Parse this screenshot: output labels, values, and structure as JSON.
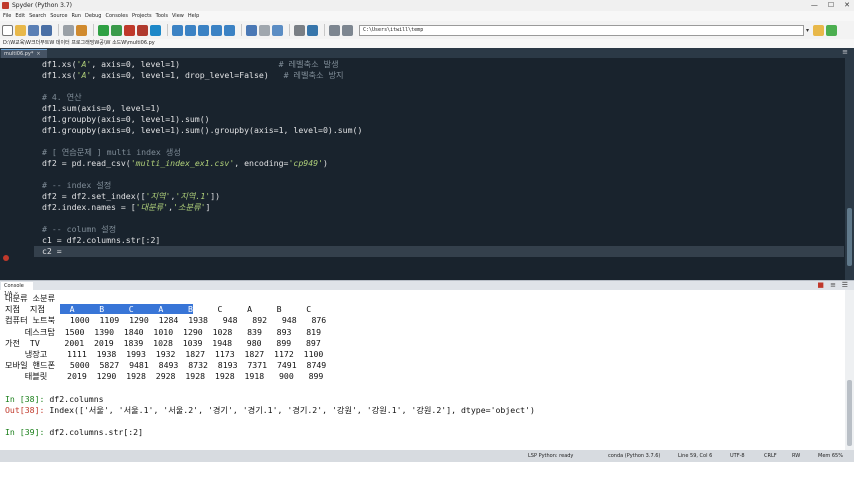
{
  "window": {
    "title": "Spyder (Python 3.7)",
    "controls": {
      "minimize": "—",
      "maximize": "☐",
      "close": "✕"
    }
  },
  "menu": [
    "File",
    "Edit",
    "Search",
    "Source",
    "Run",
    "Debug",
    "Consoles",
    "Projects",
    "Tools",
    "View",
    "Help"
  ],
  "toolbar": {
    "path_value": "C:\\Users\\itwill\\temp",
    "path_dropdown": "▾"
  },
  "file_path": "D:\\W교육\\W크더부트W 데이터 프로그래밍W공\\W 소드W\\multi06.py",
  "editor": {
    "tab_label": "multi06.py*",
    "tab_close": "×",
    "tab_menu": "≡",
    "lines": [
      {
        "no": "42",
        "parts": [
          {
            "t": "df1.xs(",
            "c": ""
          },
          {
            "t": "'A'",
            "c": "str"
          },
          {
            "t": ", axis=0, level=1)                    ",
            "c": ""
          },
          {
            "t": "# 레벨축소 발생",
            "c": "cmt"
          }
        ]
      },
      {
        "no": "43",
        "parts": [
          {
            "t": "df1.xs(",
            "c": ""
          },
          {
            "t": "'A'",
            "c": "str"
          },
          {
            "t": ", axis=0, level=1, drop_level=False)   ",
            "c": ""
          },
          {
            "t": "# 레벨축소 방지",
            "c": "cmt"
          }
        ]
      },
      {
        "no": "44",
        "parts": []
      },
      {
        "no": "45",
        "parts": [
          {
            "t": "# 4. 연산",
            "c": "cmt"
          }
        ]
      },
      {
        "no": "46",
        "parts": [
          {
            "t": "df1.sum(axis=0, level=1)",
            "c": ""
          }
        ]
      },
      {
        "no": "47",
        "parts": [
          {
            "t": "df1.groupby(axis=0, level=1).sum()",
            "c": ""
          }
        ]
      },
      {
        "no": "48",
        "parts": [
          {
            "t": "df1.groupby(axis=0, level=1).sum().groupby(axis=1, level=0).sum()",
            "c": ""
          }
        ]
      },
      {
        "no": "49",
        "parts": []
      },
      {
        "no": "50",
        "parts": [
          {
            "t": "# [ 연습문제 ] multi index 생성",
            "c": "cmt"
          }
        ]
      },
      {
        "no": "51",
        "parts": [
          {
            "t": "df2 = pd.read_csv(",
            "c": ""
          },
          {
            "t": "'multi_index_ex1.csv'",
            "c": "str"
          },
          {
            "t": ", encoding=",
            "c": ""
          },
          {
            "t": "'cp949'",
            "c": "str"
          },
          {
            "t": ")",
            "c": ""
          }
        ]
      },
      {
        "no": "52",
        "parts": []
      },
      {
        "no": "53",
        "parts": [
          {
            "t": "# -- index 설정",
            "c": "cmt"
          }
        ]
      },
      {
        "no": "54",
        "parts": [
          {
            "t": "df2 = df2.set_index([",
            "c": ""
          },
          {
            "t": "'지역'",
            "c": "str"
          },
          {
            "t": ",",
            "c": ""
          },
          {
            "t": "'지역.1'",
            "c": "str"
          },
          {
            "t": "])",
            "c": ""
          }
        ]
      },
      {
        "no": "55",
        "parts": [
          {
            "t": "df2.index.names = [",
            "c": ""
          },
          {
            "t": "'대분류'",
            "c": "str"
          },
          {
            "t": ",",
            "c": ""
          },
          {
            "t": "'소분류'",
            "c": "str"
          },
          {
            "t": "]",
            "c": ""
          }
        ]
      },
      {
        "no": "56",
        "parts": []
      },
      {
        "no": "57",
        "parts": [
          {
            "t": "# -- column 설정",
            "c": "cmt"
          }
        ]
      },
      {
        "no": "58",
        "parts": [
          {
            "t": "c1 = df2.columns.str[:2]",
            "c": ""
          }
        ]
      },
      {
        "no": "59",
        "parts": [
          {
            "t": "c2 = ",
            "c": ""
          }
        ],
        "current": true
      }
    ]
  },
  "console": {
    "tab_label": "Console 1/A",
    "tab_close": "×",
    "controls": {
      "stop": "■",
      "options": "≡",
      "menu": "☰"
    },
    "lines": [
      {
        "parts": [
          {
            "t": "대분류 소분류",
            "c": ""
          }
        ]
      },
      {
        "parts": [
          {
            "t": "지점  지점   ",
            "c": ""
          },
          {
            "t": "  A     B     C     A     B",
            "c": "sel"
          },
          {
            "t": "     C     A     B     C",
            "c": ""
          }
        ]
      },
      {
        "parts": [
          {
            "t": "컴퓨터 노트북   1000  1109  1290  1284  1938   948   892   948   876",
            "c": ""
          }
        ]
      },
      {
        "parts": [
          {
            "t": "    데스크탑  1500  1390  1840  1010  1290  1028   839   893   819",
            "c": ""
          }
        ]
      },
      {
        "parts": [
          {
            "t": "가전  TV     2001  2019  1839  1028  1039  1948   980   899   897",
            "c": ""
          }
        ]
      },
      {
        "parts": [
          {
            "t": "    냉장고    1111  1938  1993  1932  1827  1173  1827  1172  1100",
            "c": ""
          }
        ]
      },
      {
        "parts": [
          {
            "t": "모바일 핸드폰   5000  5827  9481  8493  8732  8193  7371  7491  8749",
            "c": ""
          }
        ]
      },
      {
        "parts": [
          {
            "t": "    태블릿    2019  1290  1928  2928  1928  1928  1918   900   899",
            "c": ""
          }
        ]
      },
      {
        "parts": []
      },
      {
        "parts": [
          {
            "t": "In [38]: ",
            "c": "in"
          },
          {
            "t": "df2.columns",
            "c": ""
          }
        ]
      },
      {
        "parts": [
          {
            "t": "Out[38]: ",
            "c": "out"
          },
          {
            "t": "Index(['서울', '서울.1', '서울.2', '경기', '경기.1', '경기.2', '강원', '강원.1', '강원.2'], dtype='object')",
            "c": ""
          }
        ]
      },
      {
        "parts": []
      },
      {
        "parts": [
          {
            "t": "In [39]: ",
            "c": "in"
          },
          {
            "t": "df2.columns.str[:2]",
            "c": ""
          }
        ]
      }
    ]
  },
  "statusbar": {
    "lsp": "LSP Python: ready",
    "env": "conda (Python 3.7.6)",
    "position": "Line 59, Col 6",
    "encoding": "UTF-8",
    "eol": "CRLF",
    "rw": "RW",
    "memory": "Mem 65%"
  }
}
